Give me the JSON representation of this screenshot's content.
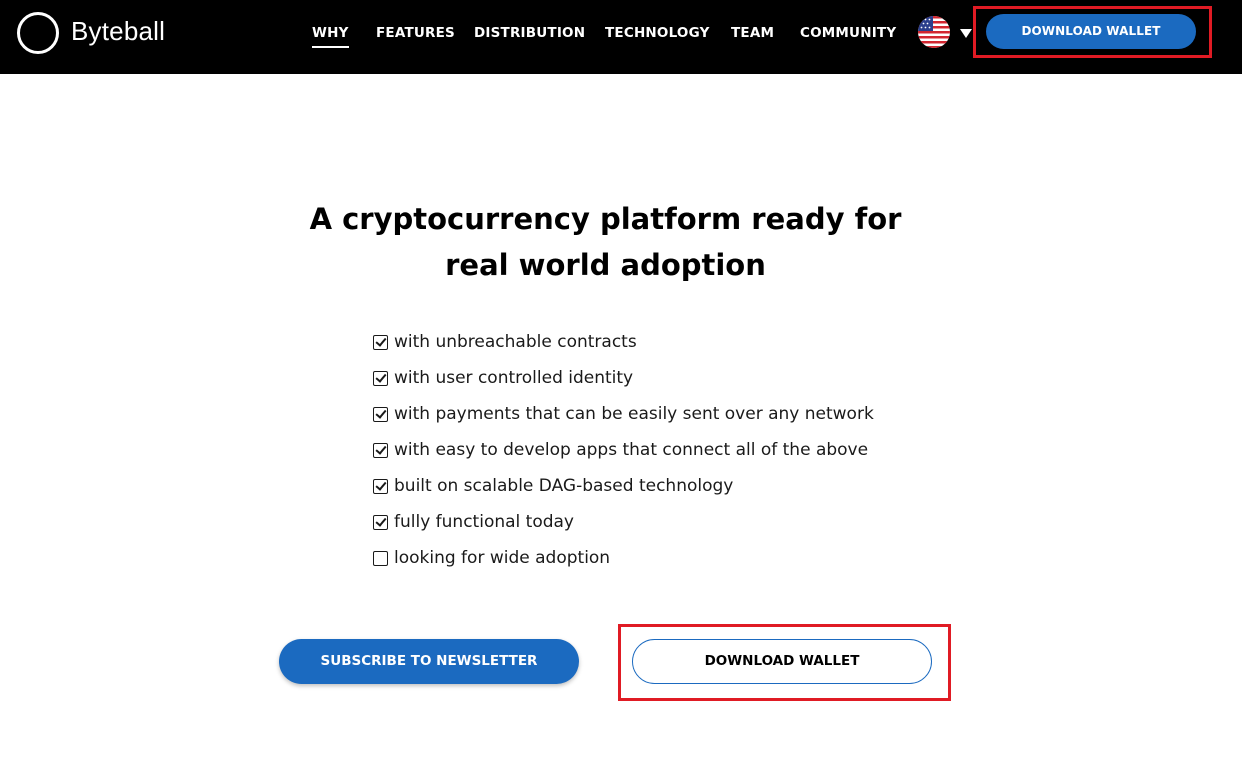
{
  "header": {
    "brand": "Byteball",
    "nav": [
      {
        "label": "WHY",
        "active": true
      },
      {
        "label": "FEATURES"
      },
      {
        "label": "DISTRIBUTION"
      },
      {
        "label": "TECHNOLOGY"
      },
      {
        "label": "TEAM"
      },
      {
        "label": "COMMUNITY"
      }
    ],
    "language_icon": "us-flag-icon",
    "download_label": "DOWNLOAD WALLET"
  },
  "hero": {
    "title_line1": "A cryptocurrency platform ready for",
    "title_line2": "real world adoption",
    "checklist": [
      {
        "text": "with unbreachable contracts",
        "checked": true
      },
      {
        "text": "with user controlled identity",
        "checked": true
      },
      {
        "text": "with payments that can be easily sent over any network",
        "checked": true
      },
      {
        "text": "with easy to develop apps that connect all of the above",
        "checked": true
      },
      {
        "text": "built on scalable DAG-based technology",
        "checked": true
      },
      {
        "text": "fully functional today",
        "checked": true
      },
      {
        "text": "looking for wide adoption",
        "checked": false
      }
    ],
    "subscribe_label": "SUBSCRIBE TO NEWSLETTER",
    "download_label": "DOWNLOAD WALLET"
  },
  "colors": {
    "navbar_bg": "#000000",
    "primary_blue": "#1b6ac0",
    "highlight_red": "#e01b24"
  }
}
